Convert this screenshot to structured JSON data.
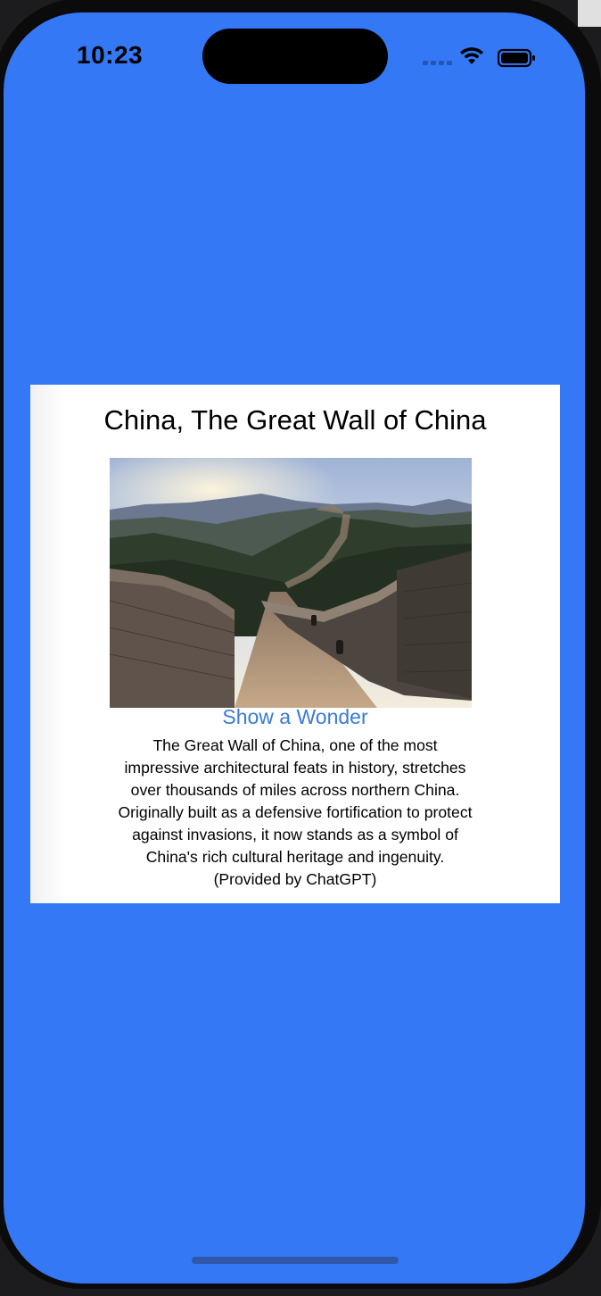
{
  "status_bar": {
    "time": "10:23"
  },
  "card": {
    "title": "China, The Great Wall of China",
    "button_label": "Show a Wonder",
    "description": "The Great Wall of China, one of the most impressive architectural feats in history, stretches over thousands of miles across northern China. Originally built as a defensive fortification to protect against invasions, it now stands as a symbol of China's rich cultural heritage and ingenuity.(Provided by ChatGPT)"
  },
  "colors": {
    "background": "#3478f6",
    "card": "#ffffff",
    "button_text": "#3a7bd5"
  },
  "icons": [
    "wifi-icon",
    "battery-icon",
    "cellular-signal-icon"
  ]
}
